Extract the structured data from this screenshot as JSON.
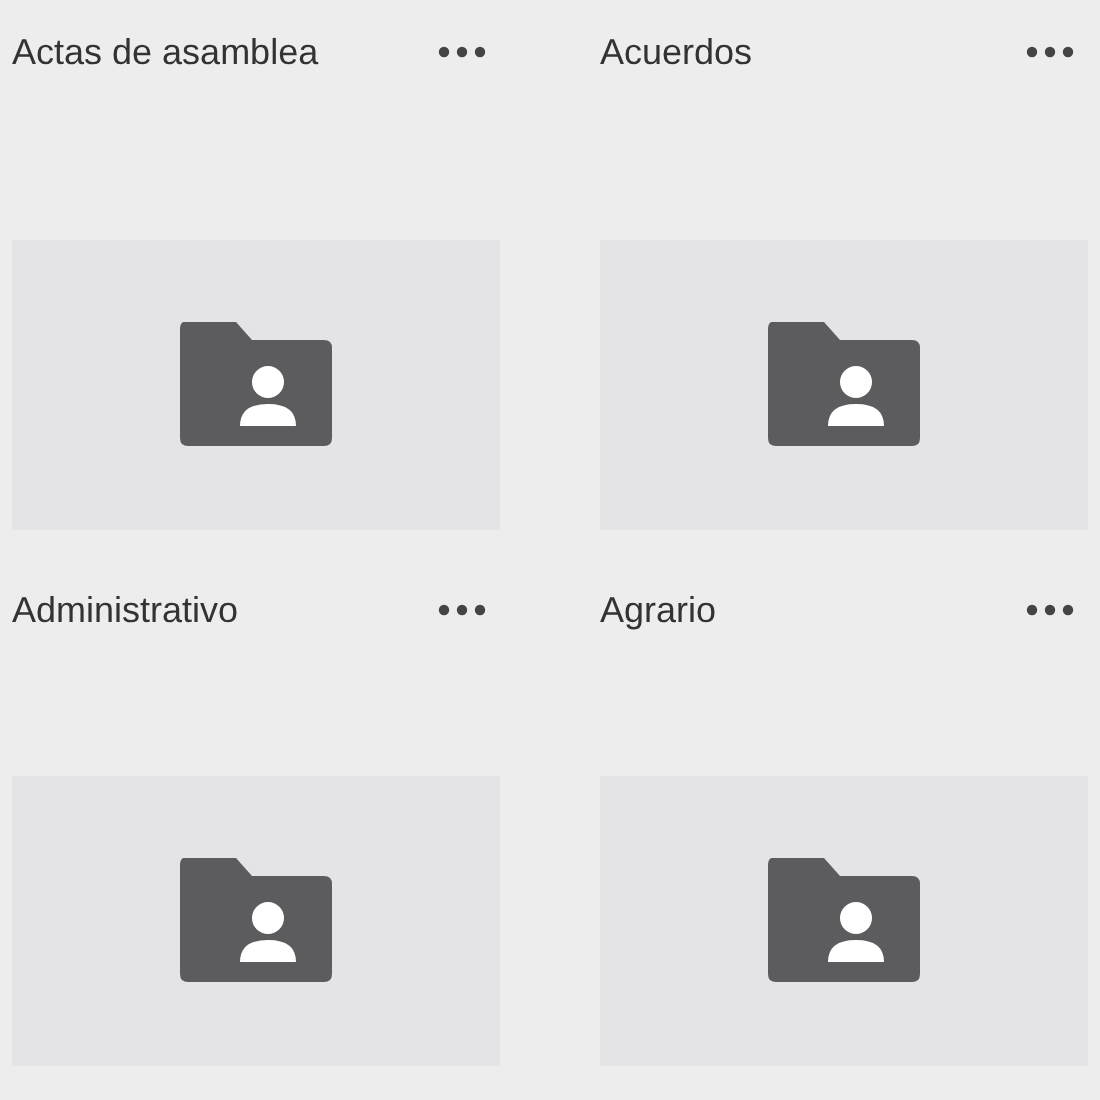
{
  "folders": [
    {
      "name": "Actas de asamblea"
    },
    {
      "name": "Acuerdos"
    },
    {
      "name": "Administrativo"
    },
    {
      "name": "Agrario"
    }
  ]
}
